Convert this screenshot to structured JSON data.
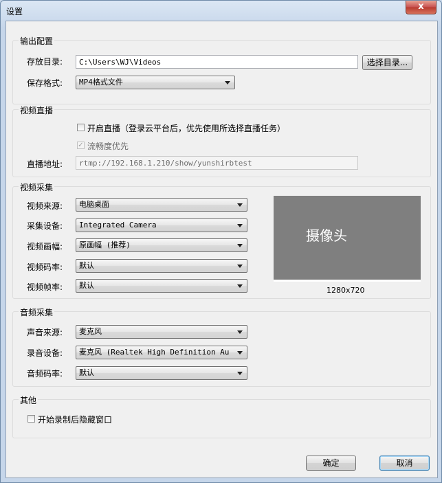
{
  "window": {
    "title": "设置",
    "close_glyph": "x"
  },
  "output": {
    "title": "输出配置",
    "dir_label": "存放目录:",
    "dir_value": "C:\\Users\\WJ\\Videos",
    "choose_dir_button": "选择目录...",
    "format_label": "保存格式:",
    "format_value": "MP4格式文件"
  },
  "live": {
    "title": "视频直播",
    "enable_label": "开启直播（登录云平台后，优先使用所选择直播任务）",
    "enable_checked": false,
    "smooth_label": "流畅度优先",
    "smooth_checked": true,
    "url_label": "直播地址:",
    "url_value": "rtmp://192.168.1.210/show/yunshirbtest"
  },
  "video": {
    "title": "视频采集",
    "source_label": "视频来源:",
    "source_value": "电脑桌面",
    "device_label": "采集设备:",
    "device_value": "Integrated Camera",
    "frame_label": "视频画幅:",
    "frame_value": "原画幅 (推荐)",
    "bitrate_label": "视频码率:",
    "bitrate_value": "默认",
    "fps_label": "视频帧率:",
    "fps_value": "默认",
    "preview_text": "摄像头",
    "resolution": "1280x720"
  },
  "audio": {
    "title": "音频采集",
    "source_label": "声音来源:",
    "source_value": "麦克风",
    "device_label": "录音设备:",
    "device_value": "麦克风 (Realtek High Definition Au",
    "bitrate_label": "音频码率:",
    "bitrate_value": "默认"
  },
  "other": {
    "title": "其他",
    "hide_label": "开始录制后隐藏窗口",
    "hide_checked": false
  },
  "footer": {
    "ok": "确定",
    "cancel": "取消"
  },
  "colors": {
    "preview_bg": "#7f7f7f",
    "titlebar": "#c6d6ea",
    "close": "#c75050"
  }
}
